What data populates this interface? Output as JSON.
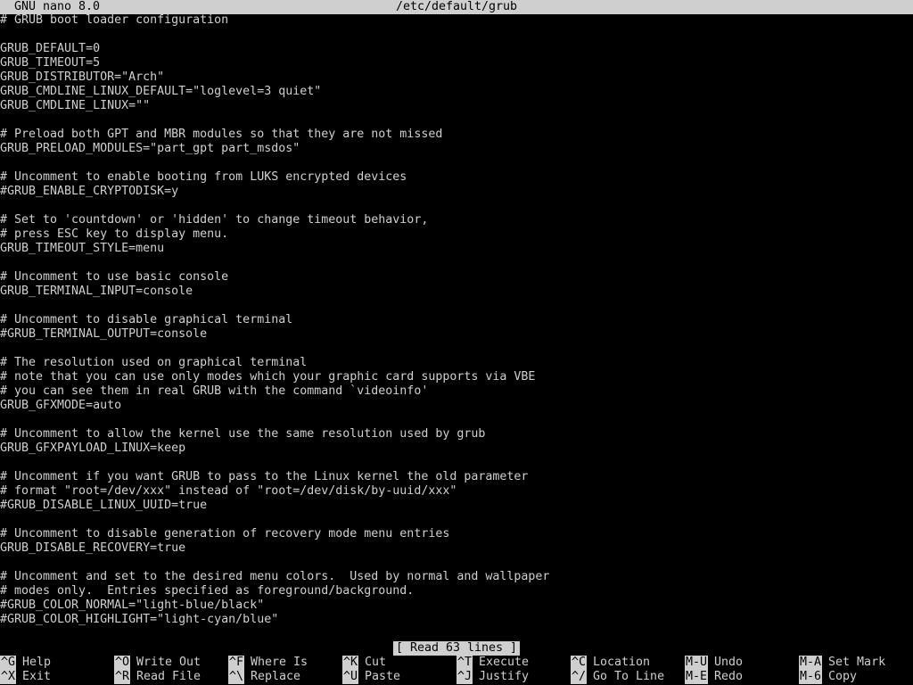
{
  "titlebar": {
    "app": "GNU nano 8.0",
    "file": "/etc/default/grub"
  },
  "editor": {
    "lines": [
      "# GRUB boot loader configuration",
      "",
      "GRUB_DEFAULT=0",
      "GRUB_TIMEOUT=5",
      "GRUB_DISTRIBUTOR=\"Arch\"",
      "GRUB_CMDLINE_LINUX_DEFAULT=\"loglevel=3 quiet\"",
      "GRUB_CMDLINE_LINUX=\"\"",
      "",
      "# Preload both GPT and MBR modules so that they are not missed",
      "GRUB_PRELOAD_MODULES=\"part_gpt part_msdos\"",
      "",
      "# Uncomment to enable booting from LUKS encrypted devices",
      "#GRUB_ENABLE_CRYPTODISK=y",
      "",
      "# Set to 'countdown' or 'hidden' to change timeout behavior,",
      "# press ESC key to display menu.",
      "GRUB_TIMEOUT_STYLE=menu",
      "",
      "# Uncomment to use basic console",
      "GRUB_TERMINAL_INPUT=console",
      "",
      "# Uncomment to disable graphical terminal",
      "#GRUB_TERMINAL_OUTPUT=console",
      "",
      "# The resolution used on graphical terminal",
      "# note that you can use only modes which your graphic card supports via VBE",
      "# you can see them in real GRUB with the command `videoinfo'",
      "GRUB_GFXMODE=auto",
      "",
      "# Uncomment to allow the kernel use the same resolution used by grub",
      "GRUB_GFXPAYLOAD_LINUX=keep",
      "",
      "# Uncomment if you want GRUB to pass to the Linux kernel the old parameter",
      "# format \"root=/dev/xxx\" instead of \"root=/dev/disk/by-uuid/xxx\"",
      "#GRUB_DISABLE_LINUX_UUID=true",
      "",
      "# Uncomment to disable generation of recovery mode menu entries",
      "GRUB_DISABLE_RECOVERY=true",
      "",
      "# Uncomment and set to the desired menu colors.  Used by normal and wallpaper",
      "# modes only.  Entries specified as foreground/background.",
      "#GRUB_COLOR_NORMAL=\"light-blue/black\"",
      "#GRUB_COLOR_HIGHLIGHT=\"light-cyan/blue\""
    ]
  },
  "status": "[ Read 63 lines ]",
  "shortcuts": [
    {
      "key": "^G",
      "label": "Help"
    },
    {
      "key": "^O",
      "label": "Write Out"
    },
    {
      "key": "^F",
      "label": "Where Is"
    },
    {
      "key": "^K",
      "label": "Cut"
    },
    {
      "key": "^T",
      "label": "Execute"
    },
    {
      "key": "^C",
      "label": "Location"
    },
    {
      "key": "M-U",
      "label": "Undo"
    },
    {
      "key": "M-A",
      "label": "Set Mark"
    },
    {
      "key": "^X",
      "label": "Exit"
    },
    {
      "key": "^R",
      "label": "Read File"
    },
    {
      "key": "^\\",
      "label": "Replace"
    },
    {
      "key": "^U",
      "label": "Paste"
    },
    {
      "key": "^J",
      "label": "Justify"
    },
    {
      "key": "^/",
      "label": "Go To Line"
    },
    {
      "key": "M-E",
      "label": "Redo"
    },
    {
      "key": "M-6",
      "label": "Copy"
    }
  ],
  "colors": {
    "background": "#000000",
    "foreground": "#cfcfcf",
    "inverse_bg": "#cfcfcf",
    "inverse_fg": "#000000"
  }
}
